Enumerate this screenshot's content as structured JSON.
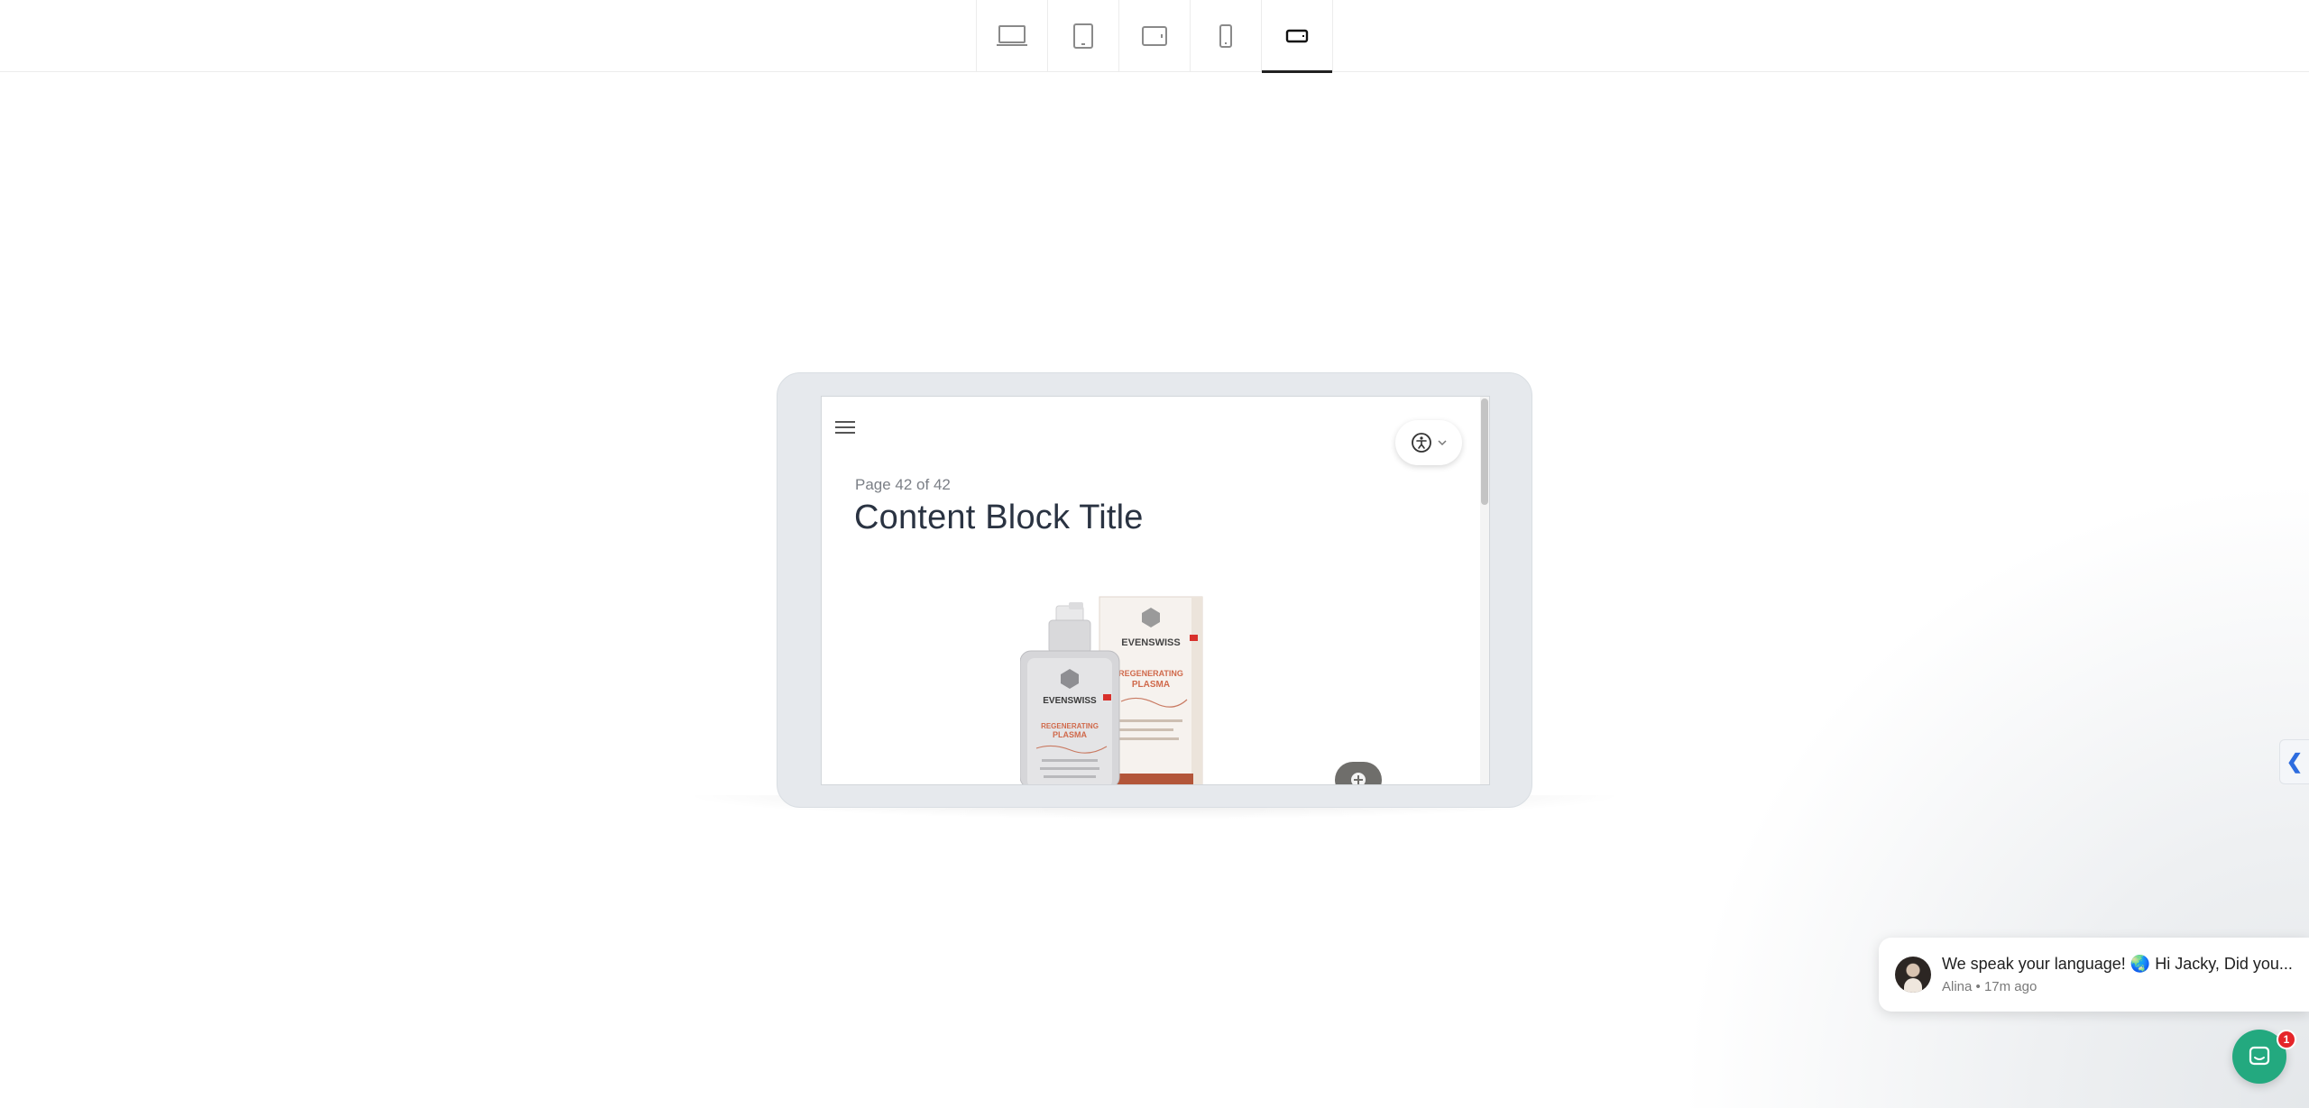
{
  "toolbar": {
    "devices": [
      {
        "name": "desktop",
        "icon": "laptop-icon",
        "active": false
      },
      {
        "name": "tablet-portrait",
        "icon": "tablet-portrait-icon",
        "active": false
      },
      {
        "name": "tablet-landscape",
        "icon": "tablet-landscape-icon",
        "active": false
      },
      {
        "name": "mobile-portrait",
        "icon": "phone-portrait-icon",
        "active": false
      },
      {
        "name": "mobile-landscape",
        "icon": "phone-landscape-icon",
        "active": true
      }
    ]
  },
  "preview": {
    "page_counter": "Page 42 of 42",
    "title": "Content Block Title",
    "product_brand": "EVENSWISS",
    "product_name": "REGENERATING PLASMA",
    "product_line2": "PLASMA"
  },
  "side_tab": {
    "glyph": "❮"
  },
  "chat": {
    "message": "We speak your language! 🌏 Hi Jacky, Did you...",
    "meta": "Alina • 17m ago",
    "badge": "1"
  },
  "colors": {
    "title": "#2a3342",
    "launcher": "#23a97f",
    "badge": "#e5252a",
    "side_tab_arrow": "#2d6cdf"
  }
}
